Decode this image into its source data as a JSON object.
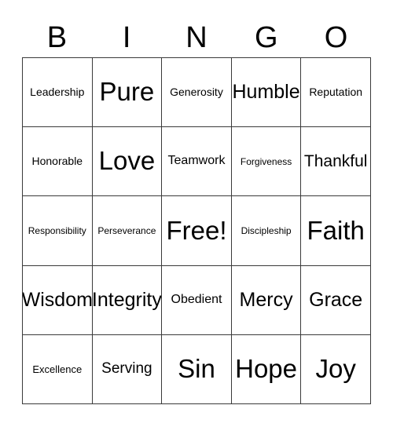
{
  "card": {
    "title": "BINGO",
    "header_letters": [
      "B",
      "I",
      "N",
      "G",
      "O"
    ],
    "border_color": "#3a3a3a",
    "background_color": "#ffffff",
    "text_color": "#000000",
    "columns": 5,
    "rows": 5,
    "free_space": "Free!",
    "free_space_position": {
      "row": 3,
      "column": 3
    },
    "cells": [
      [
        {
          "label": "Leadership",
          "size": "md"
        },
        {
          "label": "Pure",
          "size": "4xl"
        },
        {
          "label": "Generosity",
          "size": "md"
        },
        {
          "label": "Humble",
          "size": "3xl"
        },
        {
          "label": "Reputation",
          "size": "md"
        }
      ],
      [
        {
          "label": "Honorable",
          "size": "md"
        },
        {
          "label": "Love",
          "size": "4xl"
        },
        {
          "label": "Teamwork",
          "size": "lg"
        },
        {
          "label": "Forgiveness",
          "size": "xs"
        },
        {
          "label": "Thankful",
          "size": "2xl"
        }
      ],
      [
        {
          "label": "Responsibility",
          "size": "xs"
        },
        {
          "label": "Perseverance",
          "size": "xs"
        },
        {
          "label": "Free!",
          "size": "4xl"
        },
        {
          "label": "Discipleship",
          "size": "xs"
        },
        {
          "label": "Faith",
          "size": "4xl"
        }
      ],
      [
        {
          "label": "Wisdom",
          "size": "3xl"
        },
        {
          "label": "Integrity",
          "size": "3xl"
        },
        {
          "label": "Obedient",
          "size": "lg"
        },
        {
          "label": "Mercy",
          "size": "3xl"
        },
        {
          "label": "Grace",
          "size": "3xl"
        }
      ],
      [
        {
          "label": "Excellence",
          "size": "sm"
        },
        {
          "label": "Serving",
          "size": "xl"
        },
        {
          "label": "Sin",
          "size": "4xl"
        },
        {
          "label": "Hope",
          "size": "4xl"
        },
        {
          "label": "Joy",
          "size": "4xl"
        }
      ]
    ]
  }
}
